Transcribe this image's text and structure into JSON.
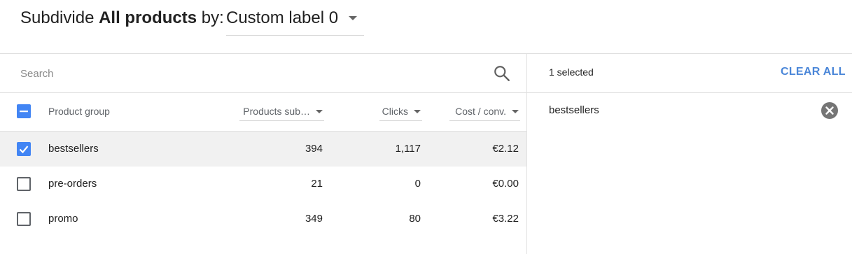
{
  "header": {
    "title_prefix": "Subdivide",
    "title_bold": "All products",
    "title_suffix": "by:",
    "dimension_value": "Custom label 0"
  },
  "search": {
    "placeholder": "Search"
  },
  "table": {
    "columns": {
      "product_group": "Product group",
      "products_submitted": "Products sub…",
      "clicks": "Clicks",
      "cost_per_conv": "Cost / conv."
    },
    "rows": [
      {
        "name": "bestsellers",
        "products": "394",
        "clicks": "1,117",
        "cost": "€2.12",
        "checked": true
      },
      {
        "name": "pre-orders",
        "products": "21",
        "clicks": "0",
        "cost": "€0.00",
        "checked": false
      },
      {
        "name": "promo",
        "products": "349",
        "clicks": "80",
        "cost": "€3.22",
        "checked": false
      }
    ]
  },
  "selection": {
    "count_text": "1 selected",
    "clear_all_label": "CLEAR ALL",
    "items": [
      "bestsellers"
    ]
  },
  "colors": {
    "accent": "#4285f4",
    "link": "#4a86d8",
    "selected_row_bg": "#f1f1f1",
    "divider": "#e0e0e0"
  }
}
